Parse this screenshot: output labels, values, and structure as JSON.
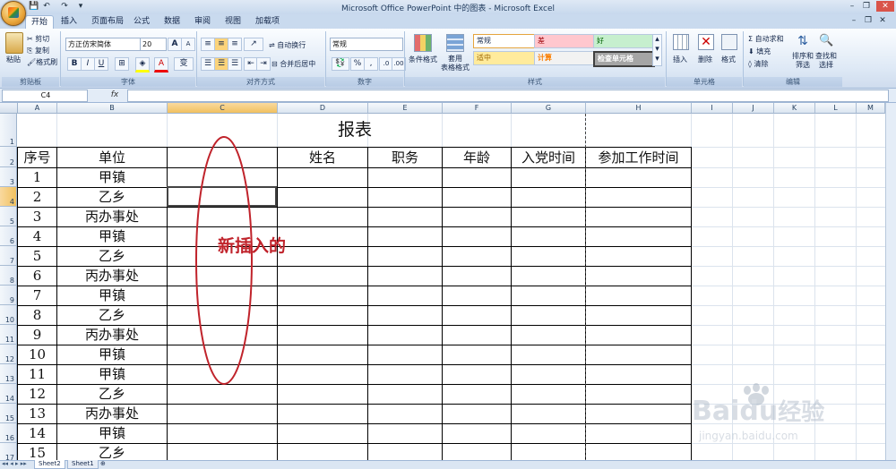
{
  "window": {
    "title": "Microsoft Office PowerPoint 中的图表 - Microsoft Excel",
    "minimize": "–",
    "restore": "❐",
    "close": "✕",
    "ribbon_minimize": "–",
    "ribbon_restore": "❐",
    "ribbon_close": "✕"
  },
  "quick_access": {
    "save": "💾",
    "undo": "↶",
    "redo": "↷",
    "more": "▾"
  },
  "tabs": [
    "开始",
    "插入",
    "页面布局",
    "公式",
    "数据",
    "审阅",
    "视图",
    "加载项"
  ],
  "ribbon": {
    "clipboard": {
      "paste": "粘贴",
      "cut": "剪切",
      "copy": "复制",
      "format_painter": "格式刷",
      "label": "剪贴板"
    },
    "font": {
      "family": "方正仿宋简体",
      "size": "20",
      "grow": "A",
      "shrink": "A",
      "bold": "B",
      "italic": "I",
      "underline": "U",
      "label": "字体",
      "wen": "变"
    },
    "alignment": {
      "wrap": "自动换行",
      "merge": "合并后居中",
      "label": "对齐方式"
    },
    "number": {
      "format": "常规",
      "percent": "%",
      "comma": ",",
      "label": "数字"
    },
    "styles": {
      "conditional": "条件格式",
      "table": "套用\n表格格式",
      "cells": [
        "常规",
        "差",
        "好",
        "适中",
        "计算",
        "检查单元格"
      ],
      "label": "样式"
    },
    "cells_group": {
      "insert": "插入",
      "delete": "删除",
      "format": "格式",
      "label": "单元格"
    },
    "editing": {
      "autosum": "自动求和",
      "fill": "填充",
      "clear": "清除",
      "sort": "排序和\n筛选",
      "find": "查找和\n选择",
      "label": "编辑"
    }
  },
  "formula_bar": {
    "name_box": "C4",
    "fx": "fx",
    "value": ""
  },
  "columns": [
    "A",
    "B",
    "C",
    "D",
    "E",
    "F",
    "G",
    "H",
    "I",
    "J",
    "K",
    "L",
    "M"
  ],
  "rows": [
    "1",
    "2",
    "3",
    "4",
    "5",
    "6",
    "7",
    "8",
    "9",
    "10",
    "11",
    "12",
    "13",
    "14",
    "15",
    "16",
    "17"
  ],
  "sheet": {
    "title": "报表",
    "headers": {
      "a": "序号",
      "b": "单位",
      "d": "姓名",
      "e": "职务",
      "f": "年龄",
      "g": "入党时间",
      "h": "参加工作时间"
    },
    "data": [
      {
        "no": "1",
        "unit": "甲镇"
      },
      {
        "no": "2",
        "unit": "乙乡"
      },
      {
        "no": "3",
        "unit": "丙办事处"
      },
      {
        "no": "4",
        "unit": "甲镇"
      },
      {
        "no": "5",
        "unit": "乙乡"
      },
      {
        "no": "6",
        "unit": "丙办事处"
      },
      {
        "no": "7",
        "unit": "甲镇"
      },
      {
        "no": "8",
        "unit": "乙乡"
      },
      {
        "no": "9",
        "unit": "丙办事处"
      },
      {
        "no": "10",
        "unit": "甲镇"
      },
      {
        "no": "11",
        "unit": "甲镇"
      },
      {
        "no": "12",
        "unit": "乙乡"
      },
      {
        "no": "13",
        "unit": "丙办事处"
      },
      {
        "no": "14",
        "unit": "甲镇"
      },
      {
        "no": "15",
        "unit": "乙乡"
      }
    ]
  },
  "annotation": {
    "text": "新插入的",
    "color": "#c0232b"
  },
  "sheet_tabs": [
    "Sheet2",
    "Sheet1"
  ],
  "watermark": {
    "brand": "Bai",
    "du": "du",
    "jingyan": "经验",
    "url": "jingyan.baidu.com"
  },
  "colors": {
    "accent": "#c0232b",
    "selected_header": "#f1c15f"
  }
}
